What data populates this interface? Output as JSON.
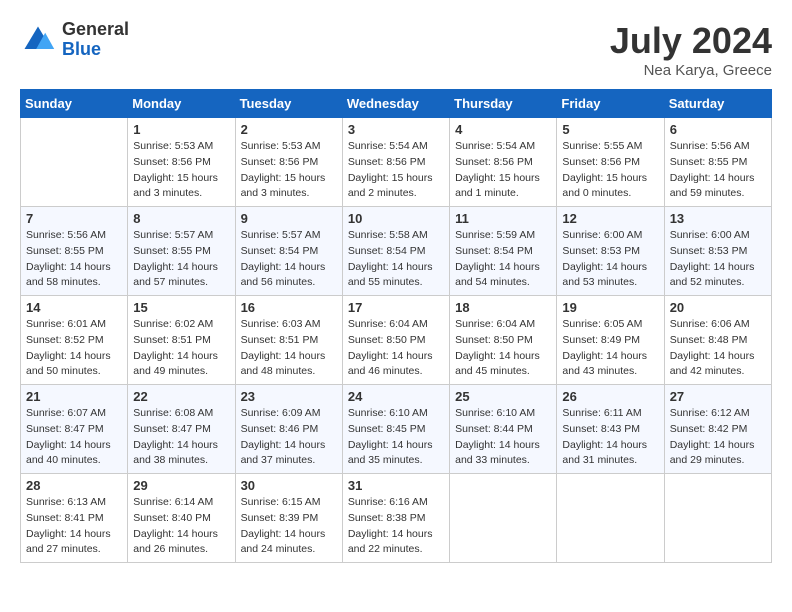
{
  "header": {
    "logo_general": "General",
    "logo_blue": "Blue",
    "month_year": "July 2024",
    "location": "Nea Karya, Greece"
  },
  "weekdays": [
    "Sunday",
    "Monday",
    "Tuesday",
    "Wednesday",
    "Thursday",
    "Friday",
    "Saturday"
  ],
  "weeks": [
    [
      {
        "day": null
      },
      {
        "day": "1",
        "sunrise": "5:53 AM",
        "sunset": "8:56 PM",
        "daylight": "15 hours and 3 minutes."
      },
      {
        "day": "2",
        "sunrise": "5:53 AM",
        "sunset": "8:56 PM",
        "daylight": "15 hours and 3 minutes."
      },
      {
        "day": "3",
        "sunrise": "5:54 AM",
        "sunset": "8:56 PM",
        "daylight": "15 hours and 2 minutes."
      },
      {
        "day": "4",
        "sunrise": "5:54 AM",
        "sunset": "8:56 PM",
        "daylight": "15 hours and 1 minute."
      },
      {
        "day": "5",
        "sunrise": "5:55 AM",
        "sunset": "8:56 PM",
        "daylight": "15 hours and 0 minutes."
      },
      {
        "day": "6",
        "sunrise": "5:56 AM",
        "sunset": "8:55 PM",
        "daylight": "14 hours and 59 minutes."
      }
    ],
    [
      {
        "day": "7",
        "sunrise": "5:56 AM",
        "sunset": "8:55 PM",
        "daylight": "14 hours and 58 minutes."
      },
      {
        "day": "8",
        "sunrise": "5:57 AM",
        "sunset": "8:55 PM",
        "daylight": "14 hours and 57 minutes."
      },
      {
        "day": "9",
        "sunrise": "5:57 AM",
        "sunset": "8:54 PM",
        "daylight": "14 hours and 56 minutes."
      },
      {
        "day": "10",
        "sunrise": "5:58 AM",
        "sunset": "8:54 PM",
        "daylight": "14 hours and 55 minutes."
      },
      {
        "day": "11",
        "sunrise": "5:59 AM",
        "sunset": "8:54 PM",
        "daylight": "14 hours and 54 minutes."
      },
      {
        "day": "12",
        "sunrise": "6:00 AM",
        "sunset": "8:53 PM",
        "daylight": "14 hours and 53 minutes."
      },
      {
        "day": "13",
        "sunrise": "6:00 AM",
        "sunset": "8:53 PM",
        "daylight": "14 hours and 52 minutes."
      }
    ],
    [
      {
        "day": "14",
        "sunrise": "6:01 AM",
        "sunset": "8:52 PM",
        "daylight": "14 hours and 50 minutes."
      },
      {
        "day": "15",
        "sunrise": "6:02 AM",
        "sunset": "8:51 PM",
        "daylight": "14 hours and 49 minutes."
      },
      {
        "day": "16",
        "sunrise": "6:03 AM",
        "sunset": "8:51 PM",
        "daylight": "14 hours and 48 minutes."
      },
      {
        "day": "17",
        "sunrise": "6:04 AM",
        "sunset": "8:50 PM",
        "daylight": "14 hours and 46 minutes."
      },
      {
        "day": "18",
        "sunrise": "6:04 AM",
        "sunset": "8:50 PM",
        "daylight": "14 hours and 45 minutes."
      },
      {
        "day": "19",
        "sunrise": "6:05 AM",
        "sunset": "8:49 PM",
        "daylight": "14 hours and 43 minutes."
      },
      {
        "day": "20",
        "sunrise": "6:06 AM",
        "sunset": "8:48 PM",
        "daylight": "14 hours and 42 minutes."
      }
    ],
    [
      {
        "day": "21",
        "sunrise": "6:07 AM",
        "sunset": "8:47 PM",
        "daylight": "14 hours and 40 minutes."
      },
      {
        "day": "22",
        "sunrise": "6:08 AM",
        "sunset": "8:47 PM",
        "daylight": "14 hours and 38 minutes."
      },
      {
        "day": "23",
        "sunrise": "6:09 AM",
        "sunset": "8:46 PM",
        "daylight": "14 hours and 37 minutes."
      },
      {
        "day": "24",
        "sunrise": "6:10 AM",
        "sunset": "8:45 PM",
        "daylight": "14 hours and 35 minutes."
      },
      {
        "day": "25",
        "sunrise": "6:10 AM",
        "sunset": "8:44 PM",
        "daylight": "14 hours and 33 minutes."
      },
      {
        "day": "26",
        "sunrise": "6:11 AM",
        "sunset": "8:43 PM",
        "daylight": "14 hours and 31 minutes."
      },
      {
        "day": "27",
        "sunrise": "6:12 AM",
        "sunset": "8:42 PM",
        "daylight": "14 hours and 29 minutes."
      }
    ],
    [
      {
        "day": "28",
        "sunrise": "6:13 AM",
        "sunset": "8:41 PM",
        "daylight": "14 hours and 27 minutes."
      },
      {
        "day": "29",
        "sunrise": "6:14 AM",
        "sunset": "8:40 PM",
        "daylight": "14 hours and 26 minutes."
      },
      {
        "day": "30",
        "sunrise": "6:15 AM",
        "sunset": "8:39 PM",
        "daylight": "14 hours and 24 minutes."
      },
      {
        "day": "31",
        "sunrise": "6:16 AM",
        "sunset": "8:38 PM",
        "daylight": "14 hours and 22 minutes."
      },
      {
        "day": null
      },
      {
        "day": null
      },
      {
        "day": null
      }
    ]
  ],
  "labels": {
    "sunrise_prefix": "Sunrise: ",
    "sunset_prefix": "Sunset: ",
    "daylight_prefix": "Daylight: "
  }
}
